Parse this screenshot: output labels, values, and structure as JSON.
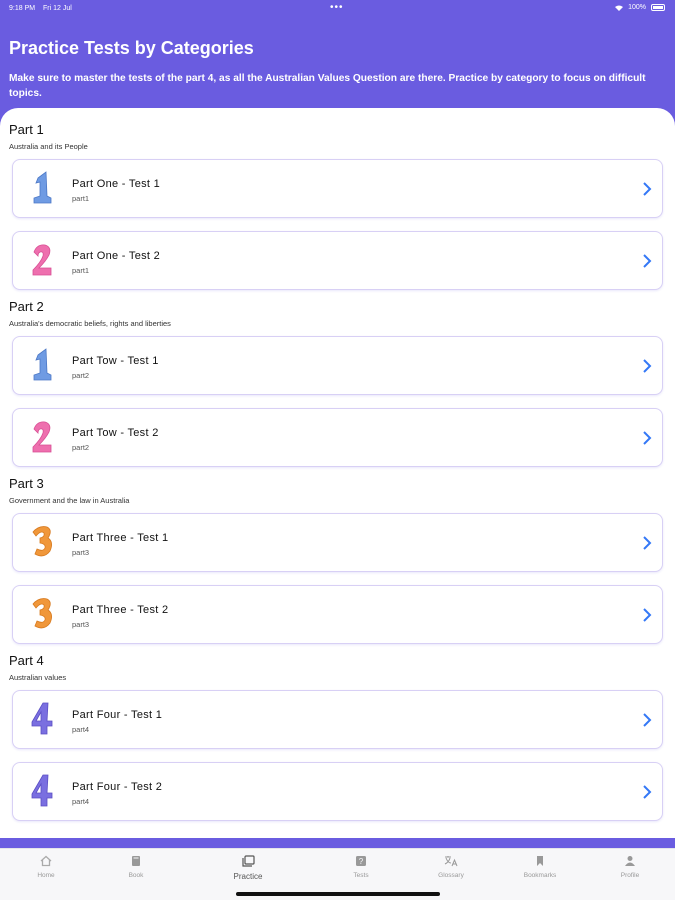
{
  "status_bar": {
    "time": "9:18 PM",
    "date": "Fri 12 Jul",
    "dots": "•••",
    "battery": "100%"
  },
  "header": {
    "title": "Practice Tests by Categories",
    "subtitle": "Make sure to master the tests of the part 4, as all the Australian Values Question are there. Practice by category to focus on difficult topics."
  },
  "sections": [
    {
      "title": "Part 1",
      "description": "Australia and its People",
      "tests": [
        {
          "title": "Part One - Test 1",
          "sub": "part1",
          "number": "1",
          "color": "#6f9be3"
        },
        {
          "title": "Part One - Test 2",
          "sub": "part1",
          "number": "2",
          "color": "#ee6fae"
        }
      ]
    },
    {
      "title": "Part 2",
      "description": "Australia's democratic beliefs, rights and liberties",
      "tests": [
        {
          "title": "Part Tow - Test 1",
          "sub": "part2",
          "number": "1",
          "color": "#6f9be3"
        },
        {
          "title": "Part Tow - Test 2",
          "sub": "part2",
          "number": "2",
          "color": "#ee6fae"
        }
      ]
    },
    {
      "title": "Part 3",
      "description": "Government and the law in Australia",
      "tests": [
        {
          "title": "Part Three - Test 1",
          "sub": "part3",
          "number": "3",
          "color": "#f0973a"
        },
        {
          "title": "Part Three - Test 2",
          "sub": "part3",
          "number": "3",
          "color": "#f0973a"
        }
      ]
    },
    {
      "title": "Part 4",
      "description": "Australian values",
      "tests": [
        {
          "title": "Part Four - Test 1",
          "sub": "part4",
          "number": "4",
          "color": "#7a6fe0"
        },
        {
          "title": "Part Four - Test 2",
          "sub": "part4",
          "number": "4",
          "color": "#7a6fe0"
        }
      ]
    }
  ],
  "tabbar": {
    "tabs": [
      {
        "label": "Home",
        "icon": "home-icon"
      },
      {
        "label": "Book",
        "icon": "book-icon"
      },
      {
        "label": "Practice",
        "icon": "practice-icon",
        "active": true
      },
      {
        "label": "Tests",
        "icon": "tests-icon"
      },
      {
        "label": "Glossary",
        "icon": "translate-icon"
      },
      {
        "label": "Bookmarks",
        "icon": "bookmark-icon"
      },
      {
        "label": "Profile",
        "icon": "profile-icon"
      }
    ]
  },
  "colors": {
    "accent": "#6a5ce0",
    "chevron": "#3478f6",
    "card_border": "#d8d0f5"
  }
}
